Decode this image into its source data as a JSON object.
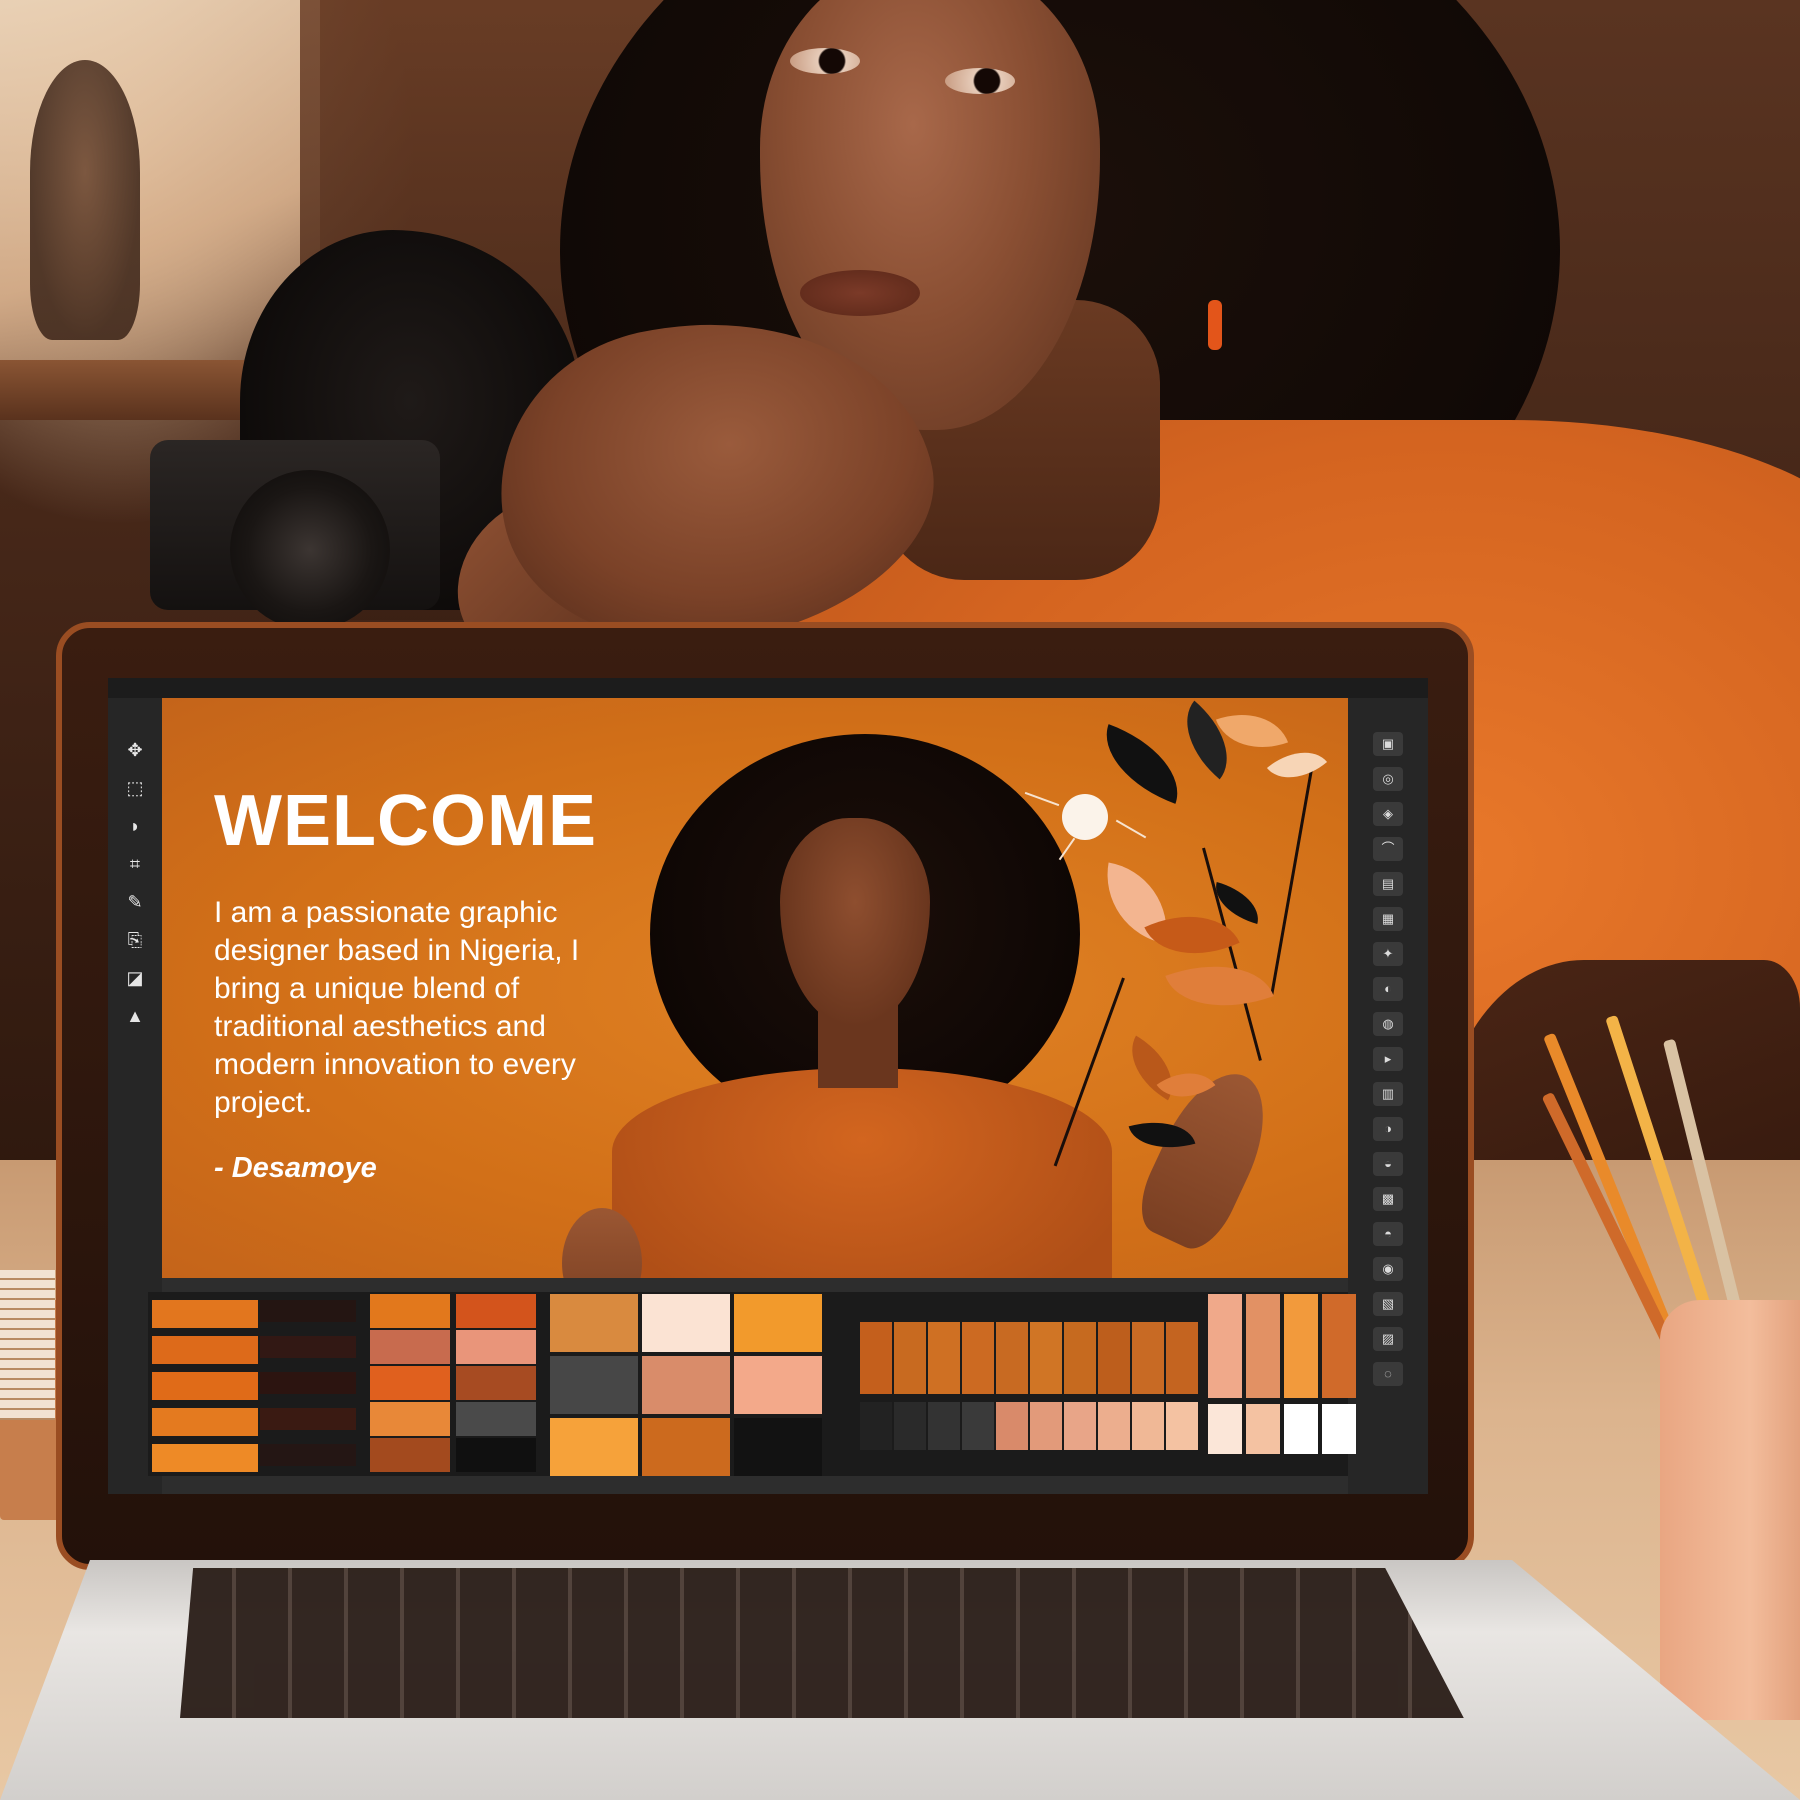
{
  "canvas": {
    "heading": "WELCOME",
    "bio": "I am a passionate graphic designer based in Nigeria, I bring a unique blend of traditional aesthetics and modern innovation to every project.",
    "signature": "- Desamoye"
  },
  "colors": {
    "canvas_orange": "#d27319",
    "sweater": "#d2651f",
    "ui_dark": "#262626"
  },
  "left_tools": [
    "move-tool-icon",
    "marquee-tool-icon",
    "lasso-tool-icon",
    "crop-tool-icon",
    "brush-tool-icon",
    "stamp-tool-icon",
    "eraser-tool-icon",
    "pen-tool-icon"
  ],
  "right_tools": [
    "layers-icon",
    "adjust-icon",
    "channels-icon",
    "paths-icon",
    "history-icon",
    "swatches-icon",
    "styles-icon",
    "brushes-icon",
    "properties-icon",
    "actions-icon",
    "libraries-icon",
    "glyphs-icon",
    "color-icon",
    "character-icon",
    "paragraph-icon",
    "navigator-icon",
    "info-icon",
    "timeline-icon",
    "notes-icon"
  ],
  "swatches": {
    "column_a": [
      "#e2761e",
      "#dd6a1a",
      "#e06b18",
      "#e47a1f",
      "#ee8a26"
    ],
    "column_b": [
      "#241512",
      "#321814",
      "#2c1410",
      "#3a1a12",
      "#241614"
    ],
    "column_c": [
      "#e2781c",
      "#c86b4e",
      "#e0601e",
      "#e88838",
      "#a34a1e"
    ],
    "column_d": [
      "#d3541c",
      "#e9957a",
      "#a74b22",
      "#4a4a4a",
      "#101010"
    ],
    "grid_e": [
      "#d98a3f",
      "#fbe3d3",
      "#f29a2c",
      "#474747",
      "#d98c6a",
      "#f3a98a",
      "#f6a23a",
      "#cc6a1e",
      "#121212"
    ],
    "strip_top": [
      "#c45f1c",
      "#c86a20",
      "#cf7023",
      "#cc6a22",
      "#c86a22",
      "#d07525",
      "#c66a1f",
      "#bd5e1c",
      "#c86a24",
      "#c46420"
    ],
    "strip_bottom": [
      "#222",
      "#2a2a2a",
      "#333",
      "#3a3a3a",
      "#d98a6a",
      "#e29a7a",
      "#e8a588",
      "#ecae8e",
      "#f0b896",
      "#f4c2a2"
    ],
    "tall": [
      "#f0a98a",
      "#e29164",
      "#f29a3c",
      "#d06a2a"
    ],
    "tall_bottom": [
      "#fbe6d8",
      "#f4c2a2",
      "#ffffff",
      "#ffffff"
    ]
  }
}
